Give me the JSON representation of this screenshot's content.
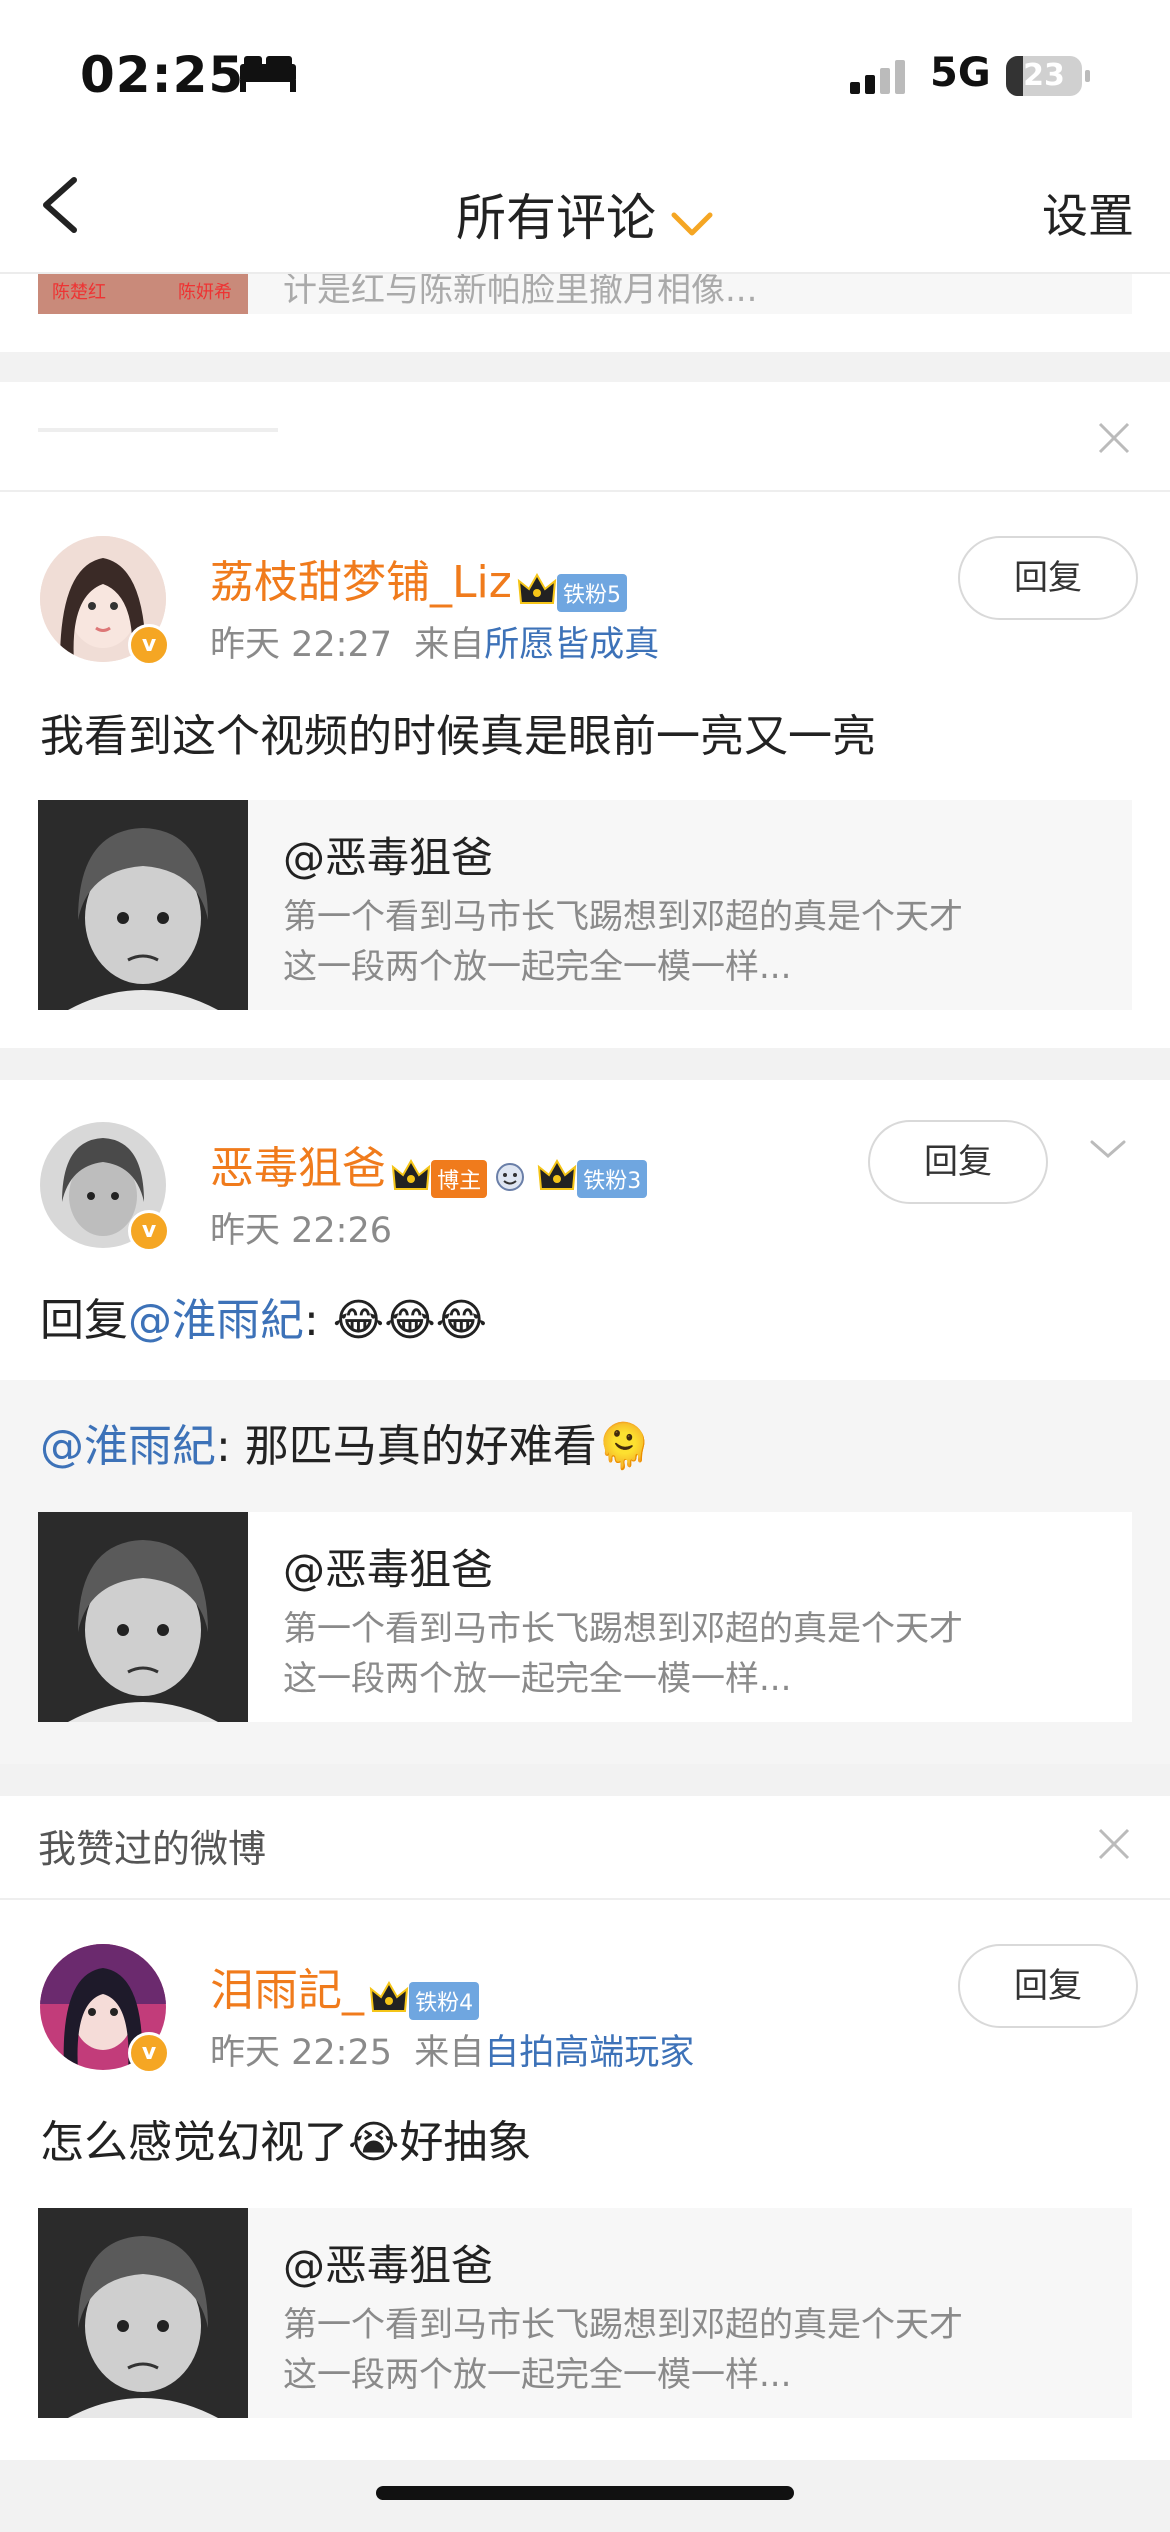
{
  "status_bar": {
    "time": "02:25",
    "network": "5G",
    "battery": "23"
  },
  "nav": {
    "title": "所有评论",
    "settings": "设置"
  },
  "top_card": {
    "truncated_text": "计是红与陈新帕脸里撤月相像...",
    "thumb_label_1": "陈楚红",
    "thumb_label_2": "陈妍希"
  },
  "comments": [
    {
      "username": "荔枝甜梦铺_Liz",
      "fan_badge": "铁粉5",
      "time": "昨天 22:27",
      "source_prefix": "来自",
      "source": "所愿皆成真",
      "text": "我看到这个视频的时候真是眼前一亮又一亮",
      "reply_label": "回复",
      "card": {
        "user": "@恶毒狙爸",
        "line1": "第一个看到马市长飞踢想到邓超的真是个天才",
        "line2": "这一段两个放一起完全一模一样..."
      }
    },
    {
      "username": "恶毒狙爸",
      "host_badge": "博主",
      "fan_badge": "铁粉3",
      "time": "昨天 22:26",
      "reply_label": "回复",
      "text_prefix": "回复",
      "mention": "@淮雨紀",
      "text_suffix": ": 😂😂😂",
      "quoted_mention": "@淮雨紀",
      "quoted_text": ": 那匹马真的好难看🫠",
      "card": {
        "user": "@恶毒狙爸",
        "line1": "第一个看到马市长飞踢想到邓超的真是个天才",
        "line2": "这一段两个放一起完全一模一样..."
      }
    },
    {
      "section_title": "我赞过的微博",
      "username": "泪雨記_",
      "fan_badge": "铁粉4",
      "time": "昨天 22:25",
      "source_prefix": "来自",
      "source": "自拍高端玩家",
      "text": "怎么感觉幻视了😭好抽象",
      "reply_label": "回复",
      "card": {
        "user": "@恶毒狙爸",
        "line1": "第一个看到马市长飞踢想到邓超的真是个天才",
        "line2": "这一段两个放一起完全一模一样..."
      }
    }
  ],
  "colors": {
    "username": "#f07b1c",
    "link": "#3d72b8",
    "fan_badge": "#6fa6e0",
    "vip": "#f5a623"
  }
}
